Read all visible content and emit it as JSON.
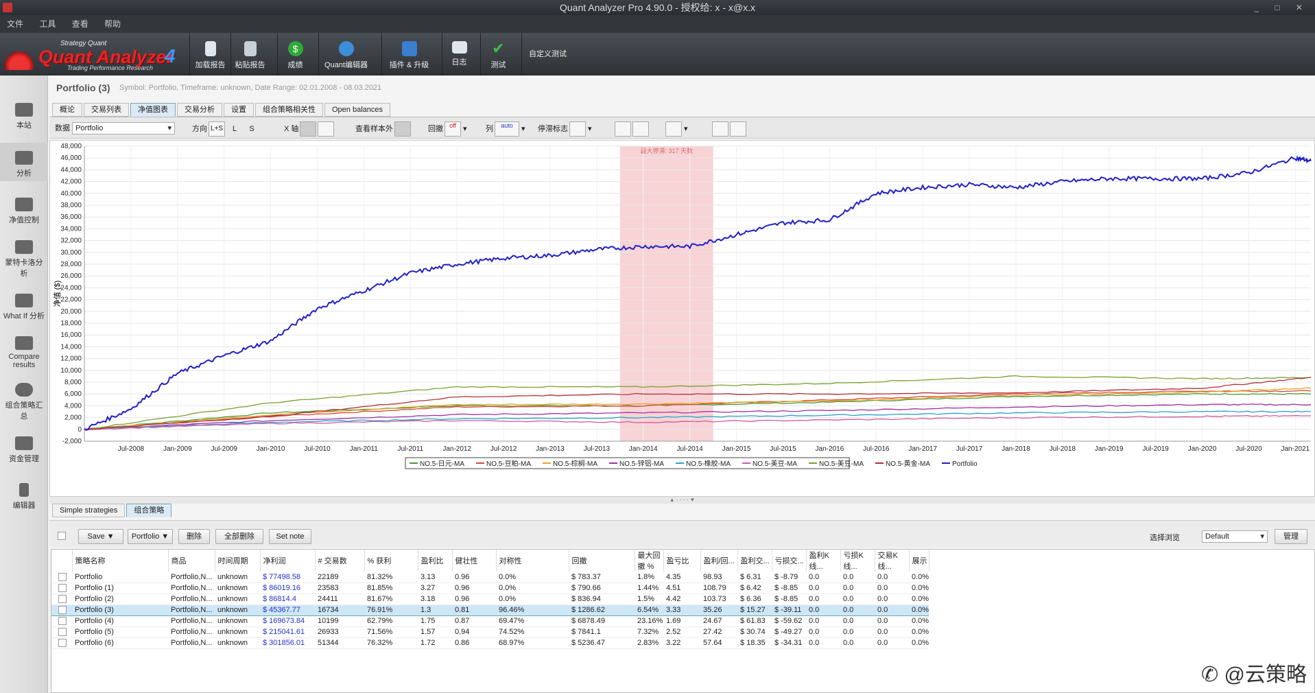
{
  "window": {
    "title": "Quant Analyzer Pro 4.90.0 - 授权给: x - x@x.x",
    "controls": "_ □ ✕"
  },
  "menu": [
    "文件",
    "工具",
    "查看",
    "帮助"
  ],
  "logo": {
    "small": "Strategy Quant",
    "big": "Quant Analyzer",
    "version": "4",
    "tagline": "Trading Performance Research"
  },
  "toolbar": [
    {
      "label": "加载报告",
      "icon": "load-report-icon",
      "color": "#dfe6ee"
    },
    {
      "label": "粘贴报告",
      "icon": "paste-report-icon",
      "color": "#c8d0da"
    },
    {
      "label": "成绩",
      "icon": "dollar-icon",
      "color": "#2faa3a"
    },
    {
      "label": "Quant编辑器",
      "icon": "globe-icon",
      "color": "#3d8ed8"
    },
    {
      "label": "插件 & 升级",
      "icon": "plugin-icon",
      "color": "#3a7fd0"
    },
    {
      "label": "日志",
      "icon": "log-icon",
      "color": "#dfe6ee"
    },
    {
      "label": "测试",
      "icon": "check-icon",
      "color": "#3fbf3f"
    },
    {
      "label": "自定义测试",
      "icon": "",
      "color": ""
    }
  ],
  "leftnav": [
    {
      "label": "本站",
      "icon": "home-icon"
    },
    {
      "label": "分析",
      "icon": "bar-chart-icon"
    },
    {
      "label": "净值控制",
      "icon": "equity-control-icon"
    },
    {
      "label": "蒙特卡洛分析",
      "icon": "monte-carlo-icon"
    },
    {
      "label": "What If 分析",
      "icon": "what-if-icon"
    },
    {
      "label": "Compare results",
      "icon": "compare-icon"
    },
    {
      "label": "组合策略汇总",
      "icon": "pie-chart-icon"
    },
    {
      "label": "资金管理",
      "icon": "money-management-icon"
    },
    {
      "label": "编辑器",
      "icon": "pencil-icon"
    }
  ],
  "page": {
    "title": "Portfolio (3)",
    "subtitle": "Symbol: Portfolio, Timeframe: unknown, Date Range: 02.01.2008 - 08.03.2021"
  },
  "tabs": [
    "概论",
    "交易列表",
    "净值图表",
    "交易分析",
    "设置",
    "组合策略相关性",
    "Open balances"
  ],
  "controls": {
    "data_label": "数据",
    "data_value": "Portfolio",
    "direction_label": "方向",
    "dir_ls": "L+S",
    "dir_l": "L",
    "dir_s": "S",
    "xaxis_label": "X 轴",
    "sample_label": "查看样本外",
    "drawdown_label": "回撤",
    "column_label": "列",
    "stagnation_label": "停滞标志",
    "off_text": "off",
    "auto_text": "auto"
  },
  "chart_data": {
    "type": "line",
    "ylabel": "净值 ($)",
    "ylim": [
      -2000,
      48000
    ],
    "yticks": [
      "48,000",
      "46,000",
      "44,000",
      "42,000",
      "40,000",
      "38,000",
      "36,000",
      "34,000",
      "32,000",
      "30,000",
      "28,000",
      "26,000",
      "24,000",
      "22,000",
      "20,000",
      "18,000",
      "16,000",
      "14,000",
      "12,000",
      "10,000",
      "8,000",
      "6,000",
      "4,000",
      "2,000",
      "0",
      "-2,000"
    ],
    "xticks": [
      "Jul-2008",
      "Jan-2009",
      "Jul-2009",
      "Jan-2010",
      "Jul-2010",
      "Jan-2011",
      "Jul-2011",
      "Jan-2012",
      "Jul-2012",
      "Jan-2013",
      "Jul-2013",
      "Jan-2014",
      "Jul-2014",
      "Jan-2015",
      "Jul-2015",
      "Jan-2016",
      "Jul-2016",
      "Jan-2017",
      "Jul-2017",
      "Jan-2018",
      "Jul-2018",
      "Jan-2019",
      "Jul-2019",
      "Jan-2020",
      "Jul-2020",
      "Jan-2021"
    ],
    "highlight": {
      "from": "Oct-2013",
      "to": "Oct-2014",
      "label": "最大停滞: 317 天数"
    },
    "series": [
      {
        "name": "NO.5-日元-MA",
        "color": "#4a9a3a",
        "x": [
          "Jan-2008",
          "Jan-2010",
          "Jan-2012",
          "Jan-2014",
          "Jan-2016",
          "Jan-2018",
          "Jan-2020",
          "Mar-2021"
        ],
        "values": [
          0,
          2800,
          4000,
          4000,
          4600,
          5600,
          6000,
          6000
        ]
      },
      {
        "name": "NO.5-豆粕-MA",
        "color": "#d84a3a",
        "x": [
          "Jan-2008",
          "Jan-2010",
          "Jan-2012",
          "Jan-2014",
          "Jan-2016",
          "Jan-2018",
          "Jan-2020",
          "Mar-2021"
        ],
        "values": [
          0,
          2200,
          3800,
          4000,
          5000,
          6000,
          6500,
          6500
        ]
      },
      {
        "name": "NO.5-棕榈-MA",
        "color": "#e8a020",
        "x": [
          "Jan-2008",
          "Jan-2010",
          "Jan-2012",
          "Jan-2014",
          "Jan-2016",
          "Jan-2018",
          "Jan-2020",
          "Mar-2021"
        ],
        "values": [
          0,
          2500,
          4200,
          4300,
          4800,
          5800,
          6300,
          7000
        ]
      },
      {
        "name": "NO.5-锌铝-MA",
        "color": "#a030a0",
        "x": [
          "Jan-2008",
          "Jan-2010",
          "Jan-2012",
          "Jan-2014",
          "Jan-2016",
          "Jan-2018",
          "Jan-2020",
          "Mar-2021"
        ],
        "values": [
          0,
          1500,
          2500,
          2800,
          3200,
          3800,
          4200,
          4200
        ]
      },
      {
        "name": "NO.5-橡胶-MA",
        "color": "#2aa0c8",
        "x": [
          "Jan-2008",
          "Jan-2010",
          "Jan-2012",
          "Jan-2014",
          "Jan-2016",
          "Jan-2018",
          "Jan-2020",
          "Mar-2021"
        ],
        "values": [
          0,
          1200,
          1800,
          2000,
          2400,
          2800,
          3000,
          3000
        ]
      },
      {
        "name": "NO.5-美豆-MA",
        "color": "#d05aa0",
        "x": [
          "Jan-2008",
          "Jan-2010",
          "Jan-2012",
          "Jan-2014",
          "Jan-2016",
          "Jan-2018",
          "Jan-2020",
          "Mar-2021"
        ],
        "values": [
          0,
          1000,
          1500,
          1200,
          1600,
          2000,
          2200,
          2300
        ]
      },
      {
        "name": "NO.5-美豆-MA",
        "color": "#7aa030",
        "x": [
          "Jan-2008",
          "Jan-2010",
          "Jan-2012",
          "Jan-2014",
          "Jan-2016",
          "Jan-2018",
          "Jan-2020",
          "Mar-2021"
        ],
        "values": [
          0,
          4500,
          7200,
          7200,
          7800,
          9000,
          8600,
          8800
        ]
      },
      {
        "name": "NO.5-黄金-MA",
        "color": "#b0303a",
        "x": [
          "Jan-2008",
          "Jan-2010",
          "Jan-2012",
          "Jan-2014",
          "Jan-2016",
          "Jan-2018",
          "Jan-2020",
          "Mar-2021"
        ],
        "values": [
          0,
          2200,
          5500,
          6000,
          6000,
          6200,
          7000,
          8800
        ]
      },
      {
        "name": "Portfolio",
        "color": "#2020c8",
        "x": [
          "Jan-2008",
          "Jul-2008",
          "Jan-2009",
          "Jul-2009",
          "Jan-2010",
          "Jul-2010",
          "Jan-2011",
          "Jul-2011",
          "Jan-2012",
          "Jul-2012",
          "Jan-2013",
          "Jul-2013",
          "Jan-2014",
          "Jul-2014",
          "Jan-2015",
          "Jul-2015",
          "Jan-2016",
          "Jul-2016",
          "Jan-2017",
          "Jul-2017",
          "Jan-2018",
          "Jul-2018",
          "Jan-2019",
          "Jul-2019",
          "Jan-2020",
          "Jul-2020",
          "Jan-2021",
          "Mar-2021"
        ],
        "values": [
          0,
          3500,
          9500,
          12500,
          15000,
          20500,
          23500,
          26500,
          28000,
          29000,
          29500,
          30500,
          31000,
          31000,
          33000,
          35000,
          35500,
          40000,
          41000,
          41500,
          41000,
          42000,
          42500,
          42500,
          42500,
          43500,
          46000,
          45500
        ]
      }
    ]
  },
  "splitter": "▲ - - - - ▼",
  "tabs2": [
    "Simple strategies",
    "组合策略"
  ],
  "buttons": {
    "save": "Save ▼",
    "portfolio": "Portfolio ▼",
    "delete": "删除",
    "delete_all": "全部删除",
    "set_note": "Set note",
    "browse_label": "选择浏览",
    "browse_value": "Default",
    "manage": "管理"
  },
  "table": {
    "headers": [
      "策略名称",
      "商品",
      "时间周期",
      "净利润",
      "# 交易数",
      "% 获利",
      "盈利比",
      "健壮性",
      "对称性",
      "回撤",
      "最大回撤 %",
      "盈亏比",
      "盈利/回...",
      "盈利交...",
      "亏损交...",
      "盈利K线...",
      "亏损K线...",
      "交易K线...",
      "展示"
    ],
    "rows": [
      [
        "Portfolio",
        "Portfolio,N...",
        "unknown",
        "$ 77498.58",
        "22189",
        "81.32%",
        "3.13",
        "0.96",
        "0.0%",
        "$ 783.37",
        "1.8%",
        "4.35",
        "98.93",
        "$ 6.31",
        "$ -8.79",
        "0.0",
        "0.0",
        "0.0",
        "0.0%"
      ],
      [
        "Portfolio (1)",
        "Portfolio,N...",
        "unknown",
        "$ 86019.16",
        "23583",
        "81.85%",
        "3.27",
        "0.96",
        "0.0%",
        "$ 790.66",
        "1.44%",
        "4.51",
        "108.79",
        "$ 6.42",
        "$ -8.85",
        "0.0",
        "0.0",
        "0.0",
        "0.0%"
      ],
      [
        "Portfolio (2)",
        "Portfolio,N...",
        "unknown",
        "$ 86814.4",
        "24411",
        "81.67%",
        "3.18",
        "0.96",
        "0.0%",
        "$ 836.94",
        "1.5%",
        "4.42",
        "103.73",
        "$ 6.36",
        "$ -8.85",
        "0.0",
        "0.0",
        "0.0",
        "0.0%"
      ],
      [
        "Portfolio (3)",
        "Portfolio,N...",
        "unknown",
        "$ 45367.77",
        "16734",
        "76.91%",
        "1.3",
        "0.81",
        "96.46%",
        "$ 1286.62",
        "6.54%",
        "3.33",
        "35.26",
        "$ 15.27",
        "$ -39.11",
        "0.0",
        "0.0",
        "0.0",
        "0.0%"
      ],
      [
        "Portfolio (4)",
        "Portfolio,N...",
        "unknown",
        "$ 169673.84",
        "10199",
        "62.79%",
        "1.75",
        "0.87",
        "69.47%",
        "$ 6878.49",
        "23.16%",
        "1.69",
        "24.67",
        "$ 61.83",
        "$ -59.62",
        "0.0",
        "0.0",
        "0.0",
        "0.0%"
      ],
      [
        "Portfolio (5)",
        "Portfolio,N...",
        "unknown",
        "$ 215041.61",
        "26933",
        "71.56%",
        "1.57",
        "0.94",
        "74.52%",
        "$ 7841.1",
        "7.32%",
        "2.52",
        "27.42",
        "$ 30.74",
        "$ -49.27",
        "0.0",
        "0.0",
        "0.0",
        "0.0%"
      ],
      [
        "Portfolio (6)",
        "Portfolio,N...",
        "unknown",
        "$ 301856.01",
        "51344",
        "76.32%",
        "1.72",
        "0.86",
        "68.97%",
        "$ 5236.47",
        "2.83%",
        "3.22",
        "57.64",
        "$ 18.35",
        "$ -34.31",
        "0.0",
        "0.0",
        "0.0",
        "0.0%"
      ]
    ],
    "selected_row": 3
  },
  "watermark": "✆ @云策略"
}
